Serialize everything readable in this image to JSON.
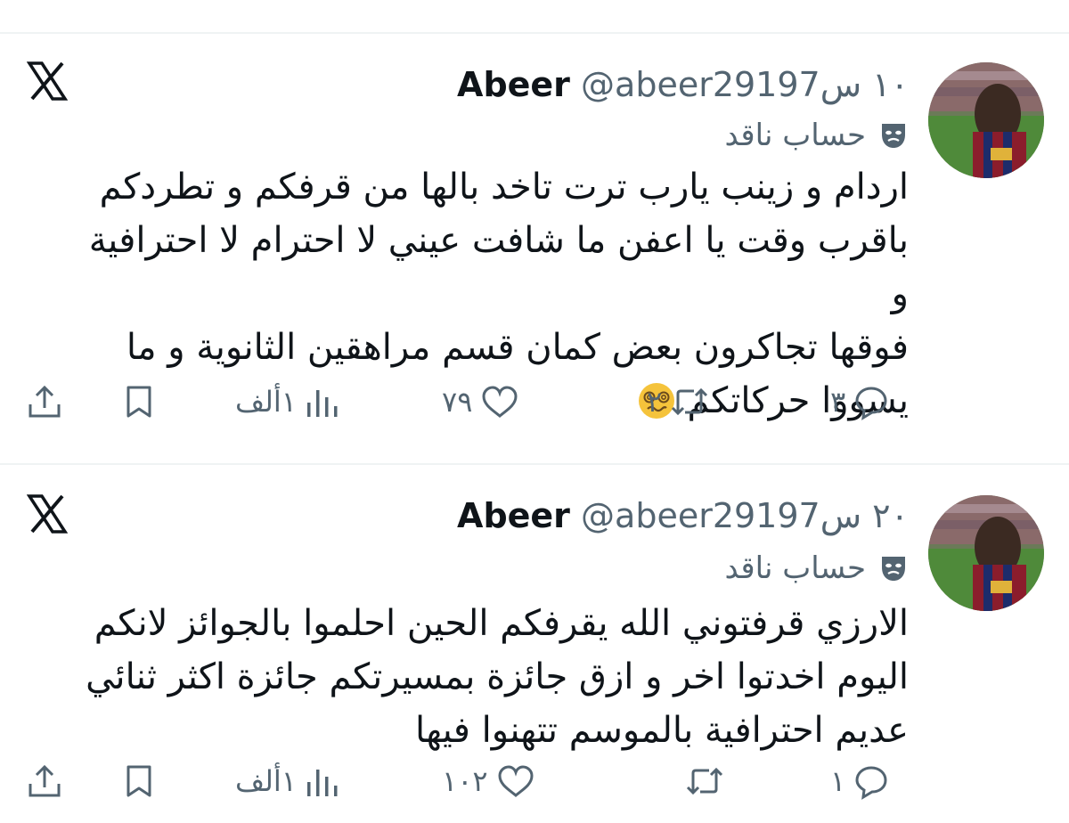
{
  "tweets": [
    {
      "name": "Abeer",
      "handle": "@abeer29197",
      "time": "١٠ س",
      "badge": "حساب ناقد",
      "lines": [
        "اردام و زينب يارب ترت تاخد بالها من قرفكم و تطردكم",
        "باقرب وقت يا اعفن ما شافت عيني لا احترام لا احترافية و",
        "فوقها تجاكرون بعض كمان قسم مراهقين الثانوية و ما",
        "يسووا حركاتكم"
      ],
      "emoji": "woozy-face",
      "replies": "٣",
      "reposts": "٢",
      "likes": "٧٩",
      "views": "١ألف"
    },
    {
      "name": "Abeer",
      "handle": "@abeer29197",
      "time": "٢٠ س",
      "badge": "حساب ناقد",
      "lines": [
        "الارزي قرفتوني الله يقرفكم الحين احلموا بالجوائز لانكم",
        "اليوم اخدتوا اخر و ازق جائزة بمسيرتكم جائزة اكثر ثنائي",
        "عديم احترافية بالموسم تتهنوا فيها"
      ],
      "replies": "١",
      "reposts": "",
      "likes": "١٠٢",
      "views": "١ألف"
    }
  ],
  "colors": {
    "text": "#0f1419",
    "secondary": "#536471",
    "divider": "#eff3f4"
  },
  "icons": [
    "x-logo-icon",
    "mask-icon",
    "reply-icon",
    "repost-icon",
    "like-icon",
    "views-icon",
    "bookmark-icon",
    "share-icon"
  ]
}
